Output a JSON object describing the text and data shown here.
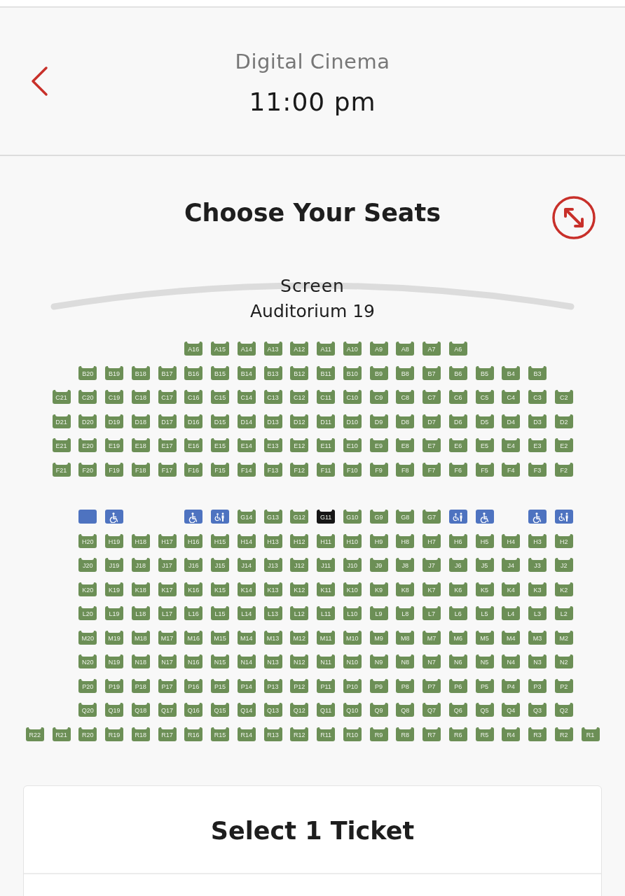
{
  "header": {
    "venue": "Digital Cinema",
    "time": "11:00 pm"
  },
  "title": "Choose Your Seats",
  "screen": {
    "label": "Screen",
    "auditorium": "Auditorium 19"
  },
  "sections": [
    {
      "rows": [
        {
          "seats": [
            {
              "kind": "gap"
            },
            {
              "kind": "gap"
            },
            {
              "kind": "gap"
            },
            {
              "kind": "gap"
            },
            {
              "kind": "gap"
            },
            {
              "kind": "gap"
            },
            {
              "kind": "seat",
              "label": "A16",
              "selected": false
            },
            {
              "kind": "seat",
              "label": "A15",
              "selected": false
            },
            {
              "kind": "seat",
              "label": "A14",
              "selected": false
            },
            {
              "kind": "seat",
              "label": "A13",
              "selected": false
            },
            {
              "kind": "seat",
              "label": "A12",
              "selected": false
            },
            {
              "kind": "seat",
              "label": "A11",
              "selected": false
            },
            {
              "kind": "seat",
              "label": "A10",
              "selected": false
            },
            {
              "kind": "seat",
              "label": "A9",
              "selected": false
            },
            {
              "kind": "seat",
              "label": "A8",
              "selected": false
            },
            {
              "kind": "seat",
              "label": "A7",
              "selected": false
            },
            {
              "kind": "seat",
              "label": "A6",
              "selected": false
            }
          ]
        },
        {
          "seats": [
            {
              "kind": "gap"
            },
            {
              "kind": "gap"
            },
            {
              "kind": "seat",
              "label": "B20",
              "selected": false
            },
            {
              "kind": "seat",
              "label": "B19",
              "selected": false
            },
            {
              "kind": "seat",
              "label": "B18",
              "selected": false
            },
            {
              "kind": "seat",
              "label": "B17",
              "selected": false
            },
            {
              "kind": "seat",
              "label": "B16",
              "selected": false
            },
            {
              "kind": "seat",
              "label": "B15",
              "selected": false
            },
            {
              "kind": "seat",
              "label": "B14",
              "selected": false
            },
            {
              "kind": "seat",
              "label": "B13",
              "selected": false
            },
            {
              "kind": "seat",
              "label": "B12",
              "selected": false
            },
            {
              "kind": "seat",
              "label": "B11",
              "selected": false
            },
            {
              "kind": "seat",
              "label": "B10",
              "selected": false
            },
            {
              "kind": "seat",
              "label": "B9",
              "selected": false
            },
            {
              "kind": "seat",
              "label": "B8",
              "selected": false
            },
            {
              "kind": "seat",
              "label": "B7",
              "selected": false
            },
            {
              "kind": "seat",
              "label": "B6",
              "selected": false
            },
            {
              "kind": "seat",
              "label": "B5",
              "selected": false
            },
            {
              "kind": "seat",
              "label": "B4",
              "selected": false
            },
            {
              "kind": "seat",
              "label": "B3",
              "selected": false
            }
          ]
        },
        {
          "seats": [
            {
              "kind": "gap"
            },
            {
              "kind": "seat",
              "label": "C21",
              "selected": false
            },
            {
              "kind": "seat",
              "label": "C20",
              "selected": false
            },
            {
              "kind": "seat",
              "label": "C19",
              "selected": false
            },
            {
              "kind": "seat",
              "label": "C18",
              "selected": false
            },
            {
              "kind": "seat",
              "label": "C17",
              "selected": false
            },
            {
              "kind": "seat",
              "label": "C16",
              "selected": false
            },
            {
              "kind": "seat",
              "label": "C15",
              "selected": false
            },
            {
              "kind": "seat",
              "label": "C14",
              "selected": false
            },
            {
              "kind": "seat",
              "label": "C13",
              "selected": false
            },
            {
              "kind": "seat",
              "label": "C12",
              "selected": false
            },
            {
              "kind": "seat",
              "label": "C11",
              "selected": false
            },
            {
              "kind": "seat",
              "label": "C10",
              "selected": false
            },
            {
              "kind": "seat",
              "label": "C9",
              "selected": false
            },
            {
              "kind": "seat",
              "label": "C8",
              "selected": false
            },
            {
              "kind": "seat",
              "label": "C7",
              "selected": false
            },
            {
              "kind": "seat",
              "label": "C6",
              "selected": false
            },
            {
              "kind": "seat",
              "label": "C5",
              "selected": false
            },
            {
              "kind": "seat",
              "label": "C4",
              "selected": false
            },
            {
              "kind": "seat",
              "label": "C3",
              "selected": false
            },
            {
              "kind": "seat",
              "label": "C2",
              "selected": false
            }
          ]
        },
        {
          "seats": [
            {
              "kind": "gap"
            },
            {
              "kind": "seat",
              "label": "D21",
              "selected": false
            },
            {
              "kind": "seat",
              "label": "D20",
              "selected": false
            },
            {
              "kind": "seat",
              "label": "D19",
              "selected": false
            },
            {
              "kind": "seat",
              "label": "D18",
              "selected": false
            },
            {
              "kind": "seat",
              "label": "D17",
              "selected": false
            },
            {
              "kind": "seat",
              "label": "D16",
              "selected": false
            },
            {
              "kind": "seat",
              "label": "D15",
              "selected": false
            },
            {
              "kind": "seat",
              "label": "D14",
              "selected": false
            },
            {
              "kind": "seat",
              "label": "D13",
              "selected": false
            },
            {
              "kind": "seat",
              "label": "D12",
              "selected": false
            },
            {
              "kind": "seat",
              "label": "D11",
              "selected": false
            },
            {
              "kind": "seat",
              "label": "D10",
              "selected": false
            },
            {
              "kind": "seat",
              "label": "D9",
              "selected": false
            },
            {
              "kind": "seat",
              "label": "D8",
              "selected": false
            },
            {
              "kind": "seat",
              "label": "D7",
              "selected": false
            },
            {
              "kind": "seat",
              "label": "D6",
              "selected": false
            },
            {
              "kind": "seat",
              "label": "D5",
              "selected": false
            },
            {
              "kind": "seat",
              "label": "D4",
              "selected": false
            },
            {
              "kind": "seat",
              "label": "D3",
              "selected": false
            },
            {
              "kind": "seat",
              "label": "D2",
              "selected": false
            }
          ]
        },
        {
          "seats": [
            {
              "kind": "gap"
            },
            {
              "kind": "seat",
              "label": "E21",
              "selected": false
            },
            {
              "kind": "seat",
              "label": "E20",
              "selected": false
            },
            {
              "kind": "seat",
              "label": "E19",
              "selected": false
            },
            {
              "kind": "seat",
              "label": "E18",
              "selected": false
            },
            {
              "kind": "seat",
              "label": "E17",
              "selected": false
            },
            {
              "kind": "seat",
              "label": "E16",
              "selected": false
            },
            {
              "kind": "seat",
              "label": "E15",
              "selected": false
            },
            {
              "kind": "seat",
              "label": "E14",
              "selected": false
            },
            {
              "kind": "seat",
              "label": "E13",
              "selected": false
            },
            {
              "kind": "seat",
              "label": "E12",
              "selected": false
            },
            {
              "kind": "seat",
              "label": "E11",
              "selected": false
            },
            {
              "kind": "seat",
              "label": "E10",
              "selected": false
            },
            {
              "kind": "seat",
              "label": "E9",
              "selected": false
            },
            {
              "kind": "seat",
              "label": "E8",
              "selected": false
            },
            {
              "kind": "seat",
              "label": "E7",
              "selected": false
            },
            {
              "kind": "seat",
              "label": "E6",
              "selected": false
            },
            {
              "kind": "seat",
              "label": "E5",
              "selected": false
            },
            {
              "kind": "seat",
              "label": "E4",
              "selected": false
            },
            {
              "kind": "seat",
              "label": "E3",
              "selected": false
            },
            {
              "kind": "seat",
              "label": "E2",
              "selected": false
            }
          ]
        },
        {
          "seats": [
            {
              "kind": "gap"
            },
            {
              "kind": "seat",
              "label": "F21",
              "selected": false
            },
            {
              "kind": "seat",
              "label": "F20",
              "selected": false
            },
            {
              "kind": "seat",
              "label": "F19",
              "selected": false
            },
            {
              "kind": "seat",
              "label": "F18",
              "selected": false
            },
            {
              "kind": "seat",
              "label": "F17",
              "selected": false
            },
            {
              "kind": "seat",
              "label": "F16",
              "selected": false
            },
            {
              "kind": "seat",
              "label": "F15",
              "selected": false
            },
            {
              "kind": "seat",
              "label": "F14",
              "selected": false
            },
            {
              "kind": "seat",
              "label": "F13",
              "selected": false
            },
            {
              "kind": "seat",
              "label": "F12",
              "selected": false
            },
            {
              "kind": "seat",
              "label": "F11",
              "selected": false
            },
            {
              "kind": "seat",
              "label": "F10",
              "selected": false
            },
            {
              "kind": "seat",
              "label": "F9",
              "selected": false
            },
            {
              "kind": "seat",
              "label": "F8",
              "selected": false
            },
            {
              "kind": "seat",
              "label": "F7",
              "selected": false
            },
            {
              "kind": "seat",
              "label": "F6",
              "selected": false
            },
            {
              "kind": "seat",
              "label": "F5",
              "selected": false
            },
            {
              "kind": "seat",
              "label": "F4",
              "selected": false
            },
            {
              "kind": "seat",
              "label": "F3",
              "selected": false
            },
            {
              "kind": "seat",
              "label": "F2",
              "selected": false
            }
          ]
        }
      ]
    },
    {
      "rows": [
        {
          "seats": [
            {
              "kind": "gap"
            },
            {
              "kind": "gap"
            },
            {
              "kind": "blocked",
              "selected": false
            },
            {
              "kind": "wheelchair",
              "selected": false
            },
            {
              "kind": "gap"
            },
            {
              "kind": "gap"
            },
            {
              "kind": "wheelchair",
              "selected": false
            },
            {
              "kind": "companion",
              "selected": false
            },
            {
              "kind": "seat",
              "label": "G14",
              "selected": false
            },
            {
              "kind": "seat",
              "label": "G13",
              "selected": false
            },
            {
              "kind": "seat",
              "label": "G12",
              "selected": false
            },
            {
              "kind": "seat",
              "label": "G11",
              "selected": true
            },
            {
              "kind": "seat",
              "label": "G10",
              "selected": false
            },
            {
              "kind": "seat",
              "label": "G9",
              "selected": false
            },
            {
              "kind": "seat",
              "label": "G8",
              "selected": false
            },
            {
              "kind": "seat",
              "label": "G7",
              "selected": false
            },
            {
              "kind": "companion",
              "selected": false
            },
            {
              "kind": "wheelchair",
              "selected": false
            },
            {
              "kind": "gap"
            },
            {
              "kind": "wheelchair",
              "selected": false
            },
            {
              "kind": "companion",
              "selected": false
            }
          ]
        },
        {
          "seats": [
            {
              "kind": "gap"
            },
            {
              "kind": "gap"
            },
            {
              "kind": "seat",
              "label": "H20",
              "selected": false
            },
            {
              "kind": "seat",
              "label": "H19",
              "selected": false
            },
            {
              "kind": "seat",
              "label": "H18",
              "selected": false
            },
            {
              "kind": "seat",
              "label": "H17",
              "selected": false
            },
            {
              "kind": "seat",
              "label": "H16",
              "selected": false
            },
            {
              "kind": "seat",
              "label": "H15",
              "selected": false
            },
            {
              "kind": "seat",
              "label": "H14",
              "selected": false
            },
            {
              "kind": "seat",
              "label": "H13",
              "selected": false
            },
            {
              "kind": "seat",
              "label": "H12",
              "selected": false
            },
            {
              "kind": "seat",
              "label": "H11",
              "selected": false
            },
            {
              "kind": "seat",
              "label": "H10",
              "selected": false
            },
            {
              "kind": "seat",
              "label": "H9",
              "selected": false
            },
            {
              "kind": "seat",
              "label": "H8",
              "selected": false
            },
            {
              "kind": "seat",
              "label": "H7",
              "selected": false
            },
            {
              "kind": "seat",
              "label": "H6",
              "selected": false
            },
            {
              "kind": "seat",
              "label": "H5",
              "selected": false
            },
            {
              "kind": "seat",
              "label": "H4",
              "selected": false
            },
            {
              "kind": "seat",
              "label": "H3",
              "selected": false
            },
            {
              "kind": "seat",
              "label": "H2",
              "selected": false
            }
          ]
        },
        {
          "seats": [
            {
              "kind": "gap"
            },
            {
              "kind": "gap"
            },
            {
              "kind": "seat",
              "label": "J20",
              "selected": false
            },
            {
              "kind": "seat",
              "label": "J19",
              "selected": false
            },
            {
              "kind": "seat",
              "label": "J18",
              "selected": false
            },
            {
              "kind": "seat",
              "label": "J17",
              "selected": false
            },
            {
              "kind": "seat",
              "label": "J16",
              "selected": false
            },
            {
              "kind": "seat",
              "label": "J15",
              "selected": false
            },
            {
              "kind": "seat",
              "label": "J14",
              "selected": false
            },
            {
              "kind": "seat",
              "label": "J13",
              "selected": false
            },
            {
              "kind": "seat",
              "label": "J12",
              "selected": false
            },
            {
              "kind": "seat",
              "label": "J11",
              "selected": false
            },
            {
              "kind": "seat",
              "label": "J10",
              "selected": false
            },
            {
              "kind": "seat",
              "label": "J9",
              "selected": false
            },
            {
              "kind": "seat",
              "label": "J8",
              "selected": false
            },
            {
              "kind": "seat",
              "label": "J7",
              "selected": false
            },
            {
              "kind": "seat",
              "label": "J6",
              "selected": false
            },
            {
              "kind": "seat",
              "label": "J5",
              "selected": false
            },
            {
              "kind": "seat",
              "label": "J4",
              "selected": false
            },
            {
              "kind": "seat",
              "label": "J3",
              "selected": false
            },
            {
              "kind": "seat",
              "label": "J2",
              "selected": false
            }
          ]
        },
        {
          "seats": [
            {
              "kind": "gap"
            },
            {
              "kind": "gap"
            },
            {
              "kind": "seat",
              "label": "K20",
              "selected": false
            },
            {
              "kind": "seat",
              "label": "K19",
              "selected": false
            },
            {
              "kind": "seat",
              "label": "K18",
              "selected": false
            },
            {
              "kind": "seat",
              "label": "K17",
              "selected": false
            },
            {
              "kind": "seat",
              "label": "K16",
              "selected": false
            },
            {
              "kind": "seat",
              "label": "K15",
              "selected": false
            },
            {
              "kind": "seat",
              "label": "K14",
              "selected": false
            },
            {
              "kind": "seat",
              "label": "K13",
              "selected": false
            },
            {
              "kind": "seat",
              "label": "K12",
              "selected": false
            },
            {
              "kind": "seat",
              "label": "K11",
              "selected": false
            },
            {
              "kind": "seat",
              "label": "K10",
              "selected": false
            },
            {
              "kind": "seat",
              "label": "K9",
              "selected": false
            },
            {
              "kind": "seat",
              "label": "K8",
              "selected": false
            },
            {
              "kind": "seat",
              "label": "K7",
              "selected": false
            },
            {
              "kind": "seat",
              "label": "K6",
              "selected": false
            },
            {
              "kind": "seat",
              "label": "K5",
              "selected": false
            },
            {
              "kind": "seat",
              "label": "K4",
              "selected": false
            },
            {
              "kind": "seat",
              "label": "K3",
              "selected": false
            },
            {
              "kind": "seat",
              "label": "K2",
              "selected": false
            }
          ]
        },
        {
          "seats": [
            {
              "kind": "gap"
            },
            {
              "kind": "gap"
            },
            {
              "kind": "seat",
              "label": "L20",
              "selected": false
            },
            {
              "kind": "seat",
              "label": "L19",
              "selected": false
            },
            {
              "kind": "seat",
              "label": "L18",
              "selected": false
            },
            {
              "kind": "seat",
              "label": "L17",
              "selected": false
            },
            {
              "kind": "seat",
              "label": "L16",
              "selected": false
            },
            {
              "kind": "seat",
              "label": "L15",
              "selected": false
            },
            {
              "kind": "seat",
              "label": "L14",
              "selected": false
            },
            {
              "kind": "seat",
              "label": "L13",
              "selected": false
            },
            {
              "kind": "seat",
              "label": "L12",
              "selected": false
            },
            {
              "kind": "seat",
              "label": "L11",
              "selected": false
            },
            {
              "kind": "seat",
              "label": "L10",
              "selected": false
            },
            {
              "kind": "seat",
              "label": "L9",
              "selected": false
            },
            {
              "kind": "seat",
              "label": "L8",
              "selected": false
            },
            {
              "kind": "seat",
              "label": "L7",
              "selected": false
            },
            {
              "kind": "seat",
              "label": "L6",
              "selected": false
            },
            {
              "kind": "seat",
              "label": "L5",
              "selected": false
            },
            {
              "kind": "seat",
              "label": "L4",
              "selected": false
            },
            {
              "kind": "seat",
              "label": "L3",
              "selected": false
            },
            {
              "kind": "seat",
              "label": "L2",
              "selected": false
            }
          ]
        },
        {
          "seats": [
            {
              "kind": "gap"
            },
            {
              "kind": "gap"
            },
            {
              "kind": "seat",
              "label": "M20",
              "selected": false
            },
            {
              "kind": "seat",
              "label": "M19",
              "selected": false
            },
            {
              "kind": "seat",
              "label": "M18",
              "selected": false
            },
            {
              "kind": "seat",
              "label": "M17",
              "selected": false
            },
            {
              "kind": "seat",
              "label": "M16",
              "selected": false
            },
            {
              "kind": "seat",
              "label": "M15",
              "selected": false
            },
            {
              "kind": "seat",
              "label": "M14",
              "selected": false
            },
            {
              "kind": "seat",
              "label": "M13",
              "selected": false
            },
            {
              "kind": "seat",
              "label": "M12",
              "selected": false
            },
            {
              "kind": "seat",
              "label": "M11",
              "selected": false
            },
            {
              "kind": "seat",
              "label": "M10",
              "selected": false
            },
            {
              "kind": "seat",
              "label": "M9",
              "selected": false
            },
            {
              "kind": "seat",
              "label": "M8",
              "selected": false
            },
            {
              "kind": "seat",
              "label": "M7",
              "selected": false
            },
            {
              "kind": "seat",
              "label": "M6",
              "selected": false
            },
            {
              "kind": "seat",
              "label": "M5",
              "selected": false
            },
            {
              "kind": "seat",
              "label": "M4",
              "selected": false
            },
            {
              "kind": "seat",
              "label": "M3",
              "selected": false
            },
            {
              "kind": "seat",
              "label": "M2",
              "selected": false
            }
          ]
        },
        {
          "seats": [
            {
              "kind": "gap"
            },
            {
              "kind": "gap"
            },
            {
              "kind": "seat",
              "label": "N20",
              "selected": false
            },
            {
              "kind": "seat",
              "label": "N19",
              "selected": false
            },
            {
              "kind": "seat",
              "label": "N18",
              "selected": false
            },
            {
              "kind": "seat",
              "label": "N17",
              "selected": false
            },
            {
              "kind": "seat",
              "label": "N16",
              "selected": false
            },
            {
              "kind": "seat",
              "label": "N15",
              "selected": false
            },
            {
              "kind": "seat",
              "label": "N14",
              "selected": false
            },
            {
              "kind": "seat",
              "label": "N13",
              "selected": false
            },
            {
              "kind": "seat",
              "label": "N12",
              "selected": false
            },
            {
              "kind": "seat",
              "label": "N11",
              "selected": false
            },
            {
              "kind": "seat",
              "label": "N10",
              "selected": false
            },
            {
              "kind": "seat",
              "label": "N9",
              "selected": false
            },
            {
              "kind": "seat",
              "label": "N8",
              "selected": false
            },
            {
              "kind": "seat",
              "label": "N7",
              "selected": false
            },
            {
              "kind": "seat",
              "label": "N6",
              "selected": false
            },
            {
              "kind": "seat",
              "label": "N5",
              "selected": false
            },
            {
              "kind": "seat",
              "label": "N4",
              "selected": false
            },
            {
              "kind": "seat",
              "label": "N3",
              "selected": false
            },
            {
              "kind": "seat",
              "label": "N2",
              "selected": false
            }
          ]
        },
        {
          "seats": [
            {
              "kind": "gap"
            },
            {
              "kind": "gap"
            },
            {
              "kind": "seat",
              "label": "P20",
              "selected": false
            },
            {
              "kind": "seat",
              "label": "P19",
              "selected": false
            },
            {
              "kind": "seat",
              "label": "P18",
              "selected": false
            },
            {
              "kind": "seat",
              "label": "P17",
              "selected": false
            },
            {
              "kind": "seat",
              "label": "P16",
              "selected": false
            },
            {
              "kind": "seat",
              "label": "P15",
              "selected": false
            },
            {
              "kind": "seat",
              "label": "P14",
              "selected": false
            },
            {
              "kind": "seat",
              "label": "P13",
              "selected": false
            },
            {
              "kind": "seat",
              "label": "P12",
              "selected": false
            },
            {
              "kind": "seat",
              "label": "P11",
              "selected": false
            },
            {
              "kind": "seat",
              "label": "P10",
              "selected": false
            },
            {
              "kind": "seat",
              "label": "P9",
              "selected": false
            },
            {
              "kind": "seat",
              "label": "P8",
              "selected": false
            },
            {
              "kind": "seat",
              "label": "P7",
              "selected": false
            },
            {
              "kind": "seat",
              "label": "P6",
              "selected": false
            },
            {
              "kind": "seat",
              "label": "P5",
              "selected": false
            },
            {
              "kind": "seat",
              "label": "P4",
              "selected": false
            },
            {
              "kind": "seat",
              "label": "P3",
              "selected": false
            },
            {
              "kind": "seat",
              "label": "P2",
              "selected": false
            }
          ]
        },
        {
          "seats": [
            {
              "kind": "gap"
            },
            {
              "kind": "gap"
            },
            {
              "kind": "seat",
              "label": "Q20",
              "selected": false
            },
            {
              "kind": "seat",
              "label": "Q19",
              "selected": false
            },
            {
              "kind": "seat",
              "label": "Q18",
              "selected": false
            },
            {
              "kind": "seat",
              "label": "Q17",
              "selected": false
            },
            {
              "kind": "seat",
              "label": "Q16",
              "selected": false
            },
            {
              "kind": "seat",
              "label": "Q15",
              "selected": false
            },
            {
              "kind": "seat",
              "label": "Q14",
              "selected": false
            },
            {
              "kind": "seat",
              "label": "Q13",
              "selected": false
            },
            {
              "kind": "seat",
              "label": "Q12",
              "selected": false
            },
            {
              "kind": "seat",
              "label": "Q11",
              "selected": false
            },
            {
              "kind": "seat",
              "label": "Q10",
              "selected": false
            },
            {
              "kind": "seat",
              "label": "Q9",
              "selected": false
            },
            {
              "kind": "seat",
              "label": "Q8",
              "selected": false
            },
            {
              "kind": "seat",
              "label": "Q7",
              "selected": false
            },
            {
              "kind": "seat",
              "label": "Q6",
              "selected": false
            },
            {
              "kind": "seat",
              "label": "Q5",
              "selected": false
            },
            {
              "kind": "seat",
              "label": "Q4",
              "selected": false
            },
            {
              "kind": "seat",
              "label": "Q3",
              "selected": false
            },
            {
              "kind": "seat",
              "label": "Q2",
              "selected": false
            }
          ]
        },
        {
          "seats": [
            {
              "kind": "seat",
              "label": "R22",
              "selected": false
            },
            {
              "kind": "seat",
              "label": "R21",
              "selected": false
            },
            {
              "kind": "seat",
              "label": "R20",
              "selected": false
            },
            {
              "kind": "seat",
              "label": "R19",
              "selected": false
            },
            {
              "kind": "seat",
              "label": "R18",
              "selected": false
            },
            {
              "kind": "seat",
              "label": "R17",
              "selected": false
            },
            {
              "kind": "seat",
              "label": "R16",
              "selected": false
            },
            {
              "kind": "seat",
              "label": "R15",
              "selected": false
            },
            {
              "kind": "seat",
              "label": "R14",
              "selected": false
            },
            {
              "kind": "seat",
              "label": "R13",
              "selected": false
            },
            {
              "kind": "seat",
              "label": "R12",
              "selected": false
            },
            {
              "kind": "seat",
              "label": "R11",
              "selected": false
            },
            {
              "kind": "seat",
              "label": "R10",
              "selected": false
            },
            {
              "kind": "seat",
              "label": "R9",
              "selected": false
            },
            {
              "kind": "seat",
              "label": "R8",
              "selected": false
            },
            {
              "kind": "seat",
              "label": "R7",
              "selected": false
            },
            {
              "kind": "seat",
              "label": "R6",
              "selected": false
            },
            {
              "kind": "seat",
              "label": "R5",
              "selected": false
            },
            {
              "kind": "seat",
              "label": "R4",
              "selected": false
            },
            {
              "kind": "seat",
              "label": "R3",
              "selected": false
            },
            {
              "kind": "seat",
              "label": "R2",
              "selected": false
            },
            {
              "kind": "seat",
              "label": "R1",
              "selected": false
            }
          ]
        }
      ]
    }
  ],
  "ticket_panel": {
    "title": "Select 1 Ticket"
  }
}
